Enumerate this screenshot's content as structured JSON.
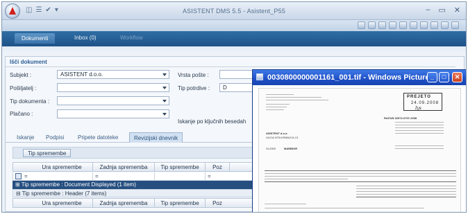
{
  "window": {
    "title": "ASISTENT DMS 5.5 - Asistent_P55",
    "controls": [
      "–",
      "▭",
      "✕"
    ]
  },
  "quick_access": [
    "◫",
    "☰",
    "✔",
    "▾"
  ],
  "main_tabs": [
    {
      "label": "Dokumenti",
      "active": true
    },
    {
      "label": "Inbox (0)",
      "active": false
    },
    {
      "label": "Workflow",
      "active": false
    }
  ],
  "search": {
    "title": "Išči dokument",
    "subjekt": {
      "label": "Subjekt :",
      "value": "ASISTENT d.o.o."
    },
    "posiljatelj": {
      "label": "Pošiljatelj :",
      "value": ""
    },
    "tip_dokumenta": {
      "label": "Tip dokumenta :",
      "value": ""
    },
    "placano": {
      "label": "Plačano :",
      "value": ""
    },
    "vrsta_poste": {
      "label": "Vrsta pošte :",
      "value": ""
    },
    "tip_potrditve": {
      "label": "Tip potrdive :",
      "value": "D"
    },
    "keyword_label": "Iskanje po ključnih besedah"
  },
  "sub_tabs": [
    {
      "label": "Iskanje",
      "active": false
    },
    {
      "label": "Podpisi",
      "active": false
    },
    {
      "label": "Pripete datoteke",
      "active": false
    },
    {
      "label": "Revizijski dnevnik",
      "active": true
    }
  ],
  "grid": {
    "group_chip": "Tip spremembe",
    "columns": [
      "Ura spremembe",
      "Zadnja sprememba",
      "Tip spremembe",
      "Poz"
    ],
    "filter_values": [
      "=",
      "=",
      "",
      "="
    ],
    "groups": [
      {
        "label": "Tip spremembe : Document Displayed (1 item)",
        "style": "dark",
        "sign": "⊞"
      },
      {
        "label": "Tip spremembe : Header (7 items)",
        "style": "light",
        "sign": "⊟"
      }
    ]
  },
  "viewer": {
    "title": "0030800000001161_001.tif - Windows Picture...",
    "doc": {
      "stamp_title": "PREJETO",
      "stamp_date": "24.09.2008",
      "stamp_sign": "Iys",
      "invoice_title": "RAČUN 32972-0707-2008",
      "recipient_name": "ASISTENT d.o.o.",
      "recipient_street": "ULICA VITA KRANJCA 13",
      "recipient_city": "MARIBOR",
      "recipient_zip": "SI-2000"
    }
  }
}
